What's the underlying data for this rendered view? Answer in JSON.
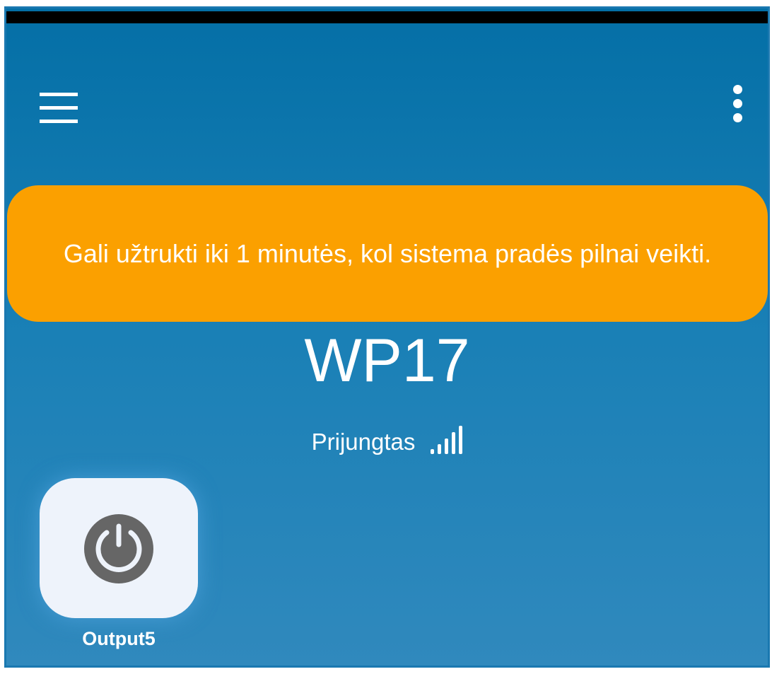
{
  "header": {
    "menu_icon": "hamburger-menu-icon",
    "more_icon": "more-vertical-icon"
  },
  "banner": {
    "text": "Gali užtrukti iki 1 minutės, kol sistema pradės pilnai veikti.",
    "color": "#fba000"
  },
  "device": {
    "name": "WP17",
    "status": "Prijungtas",
    "signal_icon": "signal-strength-icon",
    "signal_bars": 5
  },
  "outputs": [
    {
      "label": "Output5",
      "icon": "power-icon"
    }
  ],
  "colors": {
    "background_top": "#046fa6",
    "background_bottom": "#3089bd"
  }
}
